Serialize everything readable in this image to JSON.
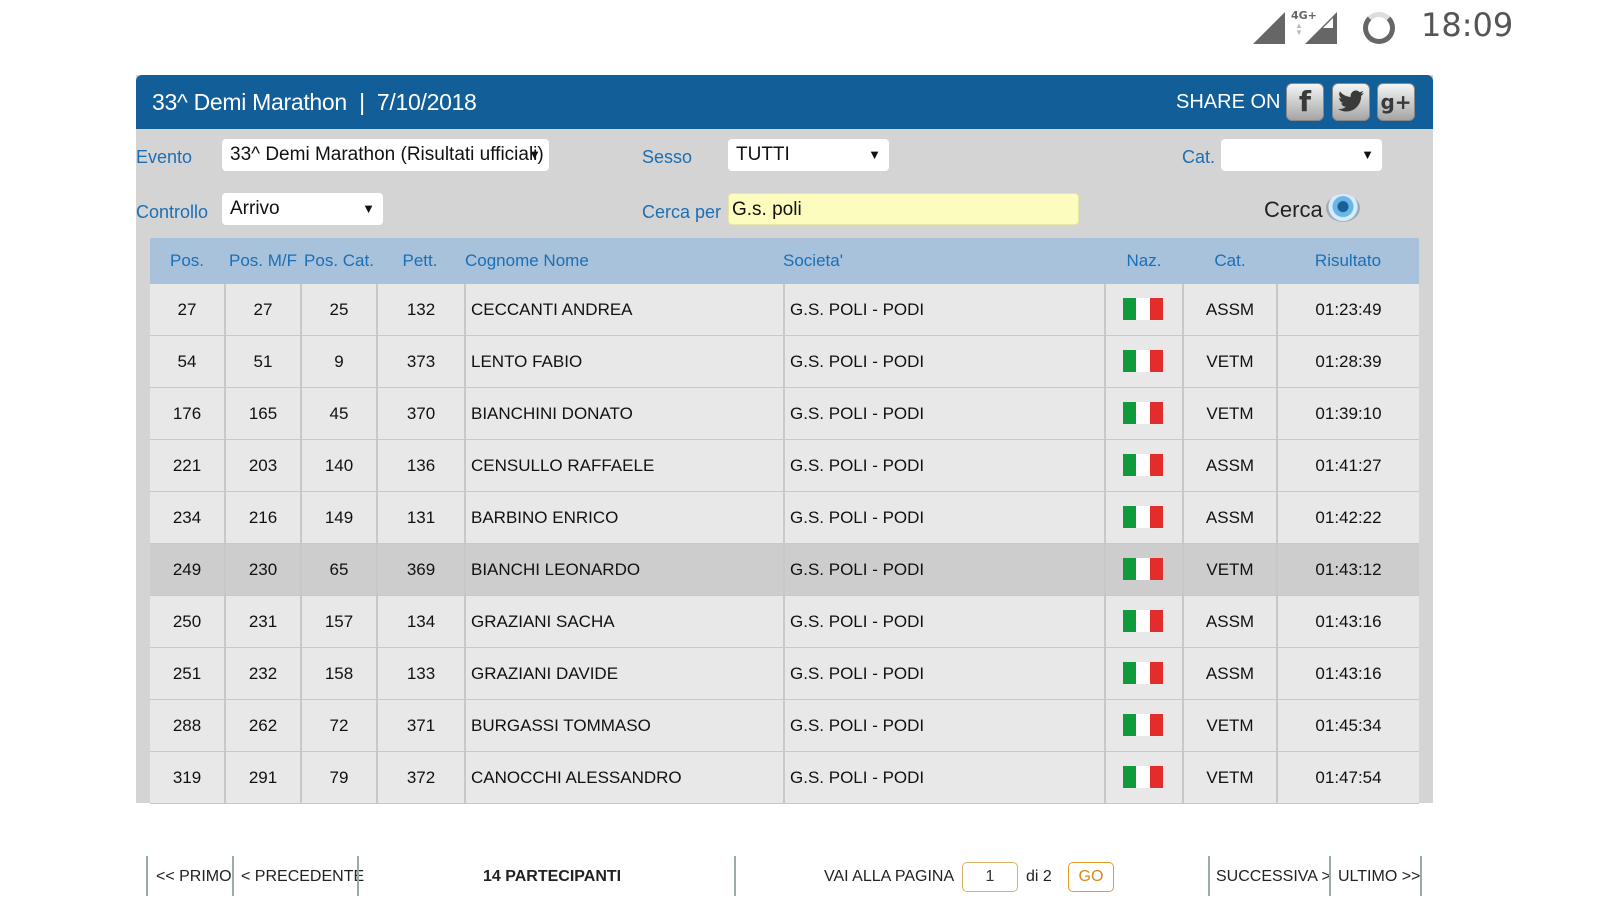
{
  "status_bar": {
    "network": "4G+",
    "time": "18:09"
  },
  "header": {
    "title": "33^ Demi Marathon  |  7/10/2018",
    "share_label": "SHARE ON"
  },
  "social": {
    "facebook": "f",
    "twitter": "🐦",
    "googleplus": "g+"
  },
  "filters": {
    "evento_label": "Evento",
    "evento_value": "33^ Demi Marathon (Risultati ufficiali)",
    "sesso_label": "Sesso",
    "sesso_value": "TUTTI",
    "cat_label": "Cat.",
    "cat_value": "",
    "controllo_label": "Controllo",
    "controllo_value": "Arrivo",
    "cerca_per_label": "Cerca per",
    "cerca_per_value": "G.s. poli",
    "search_label": "Cerca"
  },
  "table": {
    "headers": {
      "pos": "Pos.",
      "pos_mf": "Pos. M/F",
      "pos_cat": "Pos. Cat.",
      "pett": "Pett.",
      "name": "Cognome Nome",
      "societa": "Societa'",
      "naz": "Naz.",
      "cat": "Cat.",
      "risultato": "Risultato"
    },
    "rows": [
      {
        "pos": "27",
        "pos_mf": "27",
        "pos_cat": "25",
        "pett": "132",
        "name": "CECCANTI ANDREA",
        "societa": "G.S. POLI - PODI",
        "cat": "ASSM",
        "risultato": "01:23:49"
      },
      {
        "pos": "54",
        "pos_mf": "51",
        "pos_cat": "9",
        "pett": "373",
        "name": "LENTO FABIO",
        "societa": "G.S. POLI - PODI",
        "cat": "VETM",
        "risultato": "01:28:39"
      },
      {
        "pos": "176",
        "pos_mf": "165",
        "pos_cat": "45",
        "pett": "370",
        "name": "BIANCHINI DONATO",
        "societa": "G.S. POLI - PODI",
        "cat": "VETM",
        "risultato": "01:39:10"
      },
      {
        "pos": "221",
        "pos_mf": "203",
        "pos_cat": "140",
        "pett": "136",
        "name": "CENSULLO RAFFAELE",
        "societa": "G.S. POLI - PODI",
        "cat": "ASSM",
        "risultato": "01:41:27"
      },
      {
        "pos": "234",
        "pos_mf": "216",
        "pos_cat": "149",
        "pett": "131",
        "name": "BARBINO ENRICO",
        "societa": "G.S. POLI - PODI",
        "cat": "ASSM",
        "risultato": "01:42:22"
      },
      {
        "pos": "249",
        "pos_mf": "230",
        "pos_cat": "65",
        "pett": "369",
        "name": "BIANCHI LEONARDO",
        "societa": "G.S. POLI - PODI",
        "cat": "VETM",
        "risultato": "01:43:12"
      },
      {
        "pos": "250",
        "pos_mf": "231",
        "pos_cat": "157",
        "pett": "134",
        "name": "GRAZIANI SACHA",
        "societa": "G.S. POLI - PODI",
        "cat": "ASSM",
        "risultato": "01:43:16"
      },
      {
        "pos": "251",
        "pos_mf": "232",
        "pos_cat": "158",
        "pett": "133",
        "name": "GRAZIANI DAVIDE",
        "societa": "G.S. POLI - PODI",
        "cat": "ASSM",
        "risultato": "01:43:16"
      },
      {
        "pos": "288",
        "pos_mf": "262",
        "pos_cat": "72",
        "pett": "371",
        "name": "BURGASSI TOMMASO",
        "societa": "G.S. POLI - PODI",
        "cat": "VETM",
        "risultato": "01:45:34"
      },
      {
        "pos": "319",
        "pos_mf": "291",
        "pos_cat": "79",
        "pett": "372",
        "name": "CANOCCHI ALESSANDRO",
        "societa": "G.S. POLI - PODI",
        "cat": "VETM",
        "risultato": "01:47:54"
      }
    ]
  },
  "pagination": {
    "first": "<< PRIMO",
    "prev": "< PRECEDENTE",
    "count": "14 PARTECIPANTI",
    "goto_label": "VAI ALLA PAGINA",
    "page_value": "1",
    "of": "di 2",
    "go": "GO",
    "next": "SUCCESSIVA >",
    "last": "ULTIMO >>"
  },
  "colors": {
    "header_bg": "#115e98",
    "label_blue": "#1b6fb4",
    "thead_bg": "#a8c2dc",
    "row_bg": "#e8e8e8",
    "row_alt_bg": "#cdcdcd"
  }
}
